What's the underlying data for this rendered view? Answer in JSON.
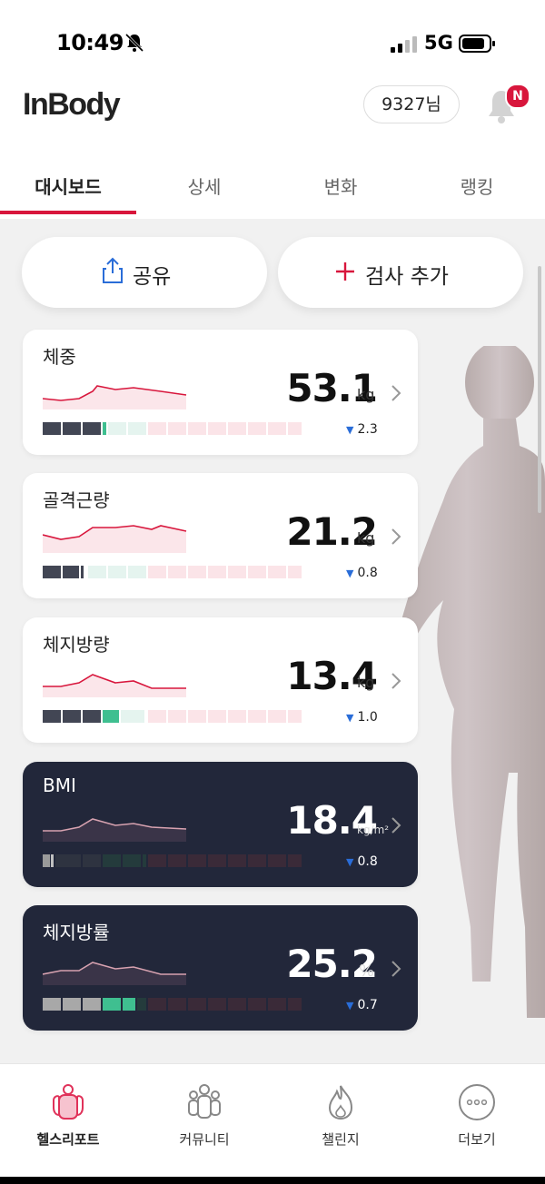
{
  "status_bar": {
    "time": "10:49",
    "network": "5G"
  },
  "header": {
    "logo": "InBody",
    "user_chip": "9327님",
    "notification_badge": "N"
  },
  "tabs": [
    "대시보드",
    "상세",
    "변화",
    "랭킹"
  ],
  "actions": {
    "share_label": "공유",
    "add_label": "검사 추가"
  },
  "cards": [
    {
      "title": "체중",
      "value": "53.1",
      "unit": "kg",
      "delta": "2.3",
      "theme": "light"
    },
    {
      "title": "골격근량",
      "value": "21.2",
      "unit": "kg",
      "delta": "0.8",
      "theme": "light"
    },
    {
      "title": "체지방량",
      "value": "13.4",
      "unit": "kg",
      "delta": "1.0",
      "theme": "light"
    },
    {
      "title": "BMI",
      "value": "18.4",
      "unit": "kg/m²",
      "delta": "0.8",
      "theme": "dark"
    },
    {
      "title": "체지방률",
      "value": "25.2",
      "unit": "%",
      "delta": "0.7",
      "theme": "dark"
    }
  ],
  "bottom_nav": [
    "헬스리포트",
    "커뮤니티",
    "챌린지",
    "더보기"
  ],
  "colors": {
    "accent": "#d8163c",
    "dark_card": "#22273a",
    "delta_arrow": "#2a6dd8"
  }
}
